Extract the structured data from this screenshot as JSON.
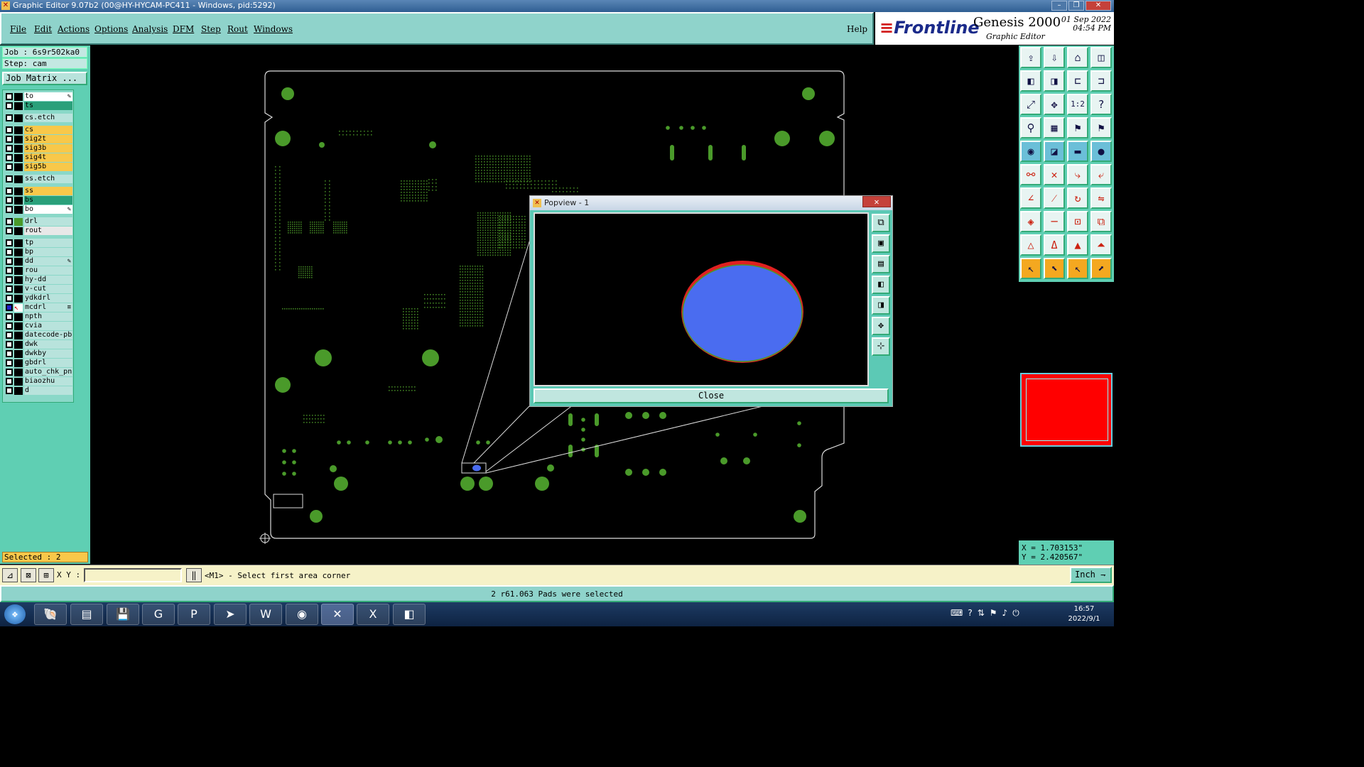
{
  "window": {
    "title": "Graphic Editor 9.07b2 (00@HY-HYCAM-PC411 - Windows, pid:5292)",
    "controls": [
      "minimize-icon",
      "maximize-icon",
      "close-icon"
    ]
  },
  "menu": {
    "items": [
      "File",
      "Edit",
      "Actions",
      "Options",
      "Analysis",
      "DFM",
      "Step",
      "Rout",
      "Windows"
    ],
    "help": "Help"
  },
  "brand": {
    "logo": "Frontline",
    "product": "Genesis 2000",
    "subtitle": "Graphic Editor",
    "date": "01 Sep 2022",
    "time": "04:54 PM"
  },
  "job": {
    "job_line": "Job : 6s9r502ka0",
    "step_line": "Step: cam",
    "matrix_button": "Job Matrix ..."
  },
  "layers": [
    {
      "name": "to",
      "color": "#ffffff",
      "mark": "✎"
    },
    {
      "name": "ts",
      "color": "#2aa07a",
      "mark": ""
    },
    {
      "name": "cs.etch",
      "color": "#b8e3dc",
      "mark": ""
    },
    {
      "name": "cs",
      "color": "#f8c84a",
      "mark": ""
    },
    {
      "name": "sig2t",
      "color": "#f8c84a",
      "mark": ""
    },
    {
      "name": "sig3b",
      "color": "#f8c84a",
      "mark": ""
    },
    {
      "name": "sig4t",
      "color": "#f8c84a",
      "mark": ""
    },
    {
      "name": "sig5b",
      "color": "#f8c84a",
      "mark": ""
    },
    {
      "name": "ss.etch",
      "color": "#b8e3dc",
      "mark": ""
    },
    {
      "name": "ss",
      "color": "#f8c84a",
      "mark": ""
    },
    {
      "name": "bs",
      "color": "#2aa07a",
      "mark": ""
    },
    {
      "name": "bo",
      "color": "#ffffff",
      "mark": "✎"
    },
    {
      "name": "drl",
      "color": "#b8e3dc",
      "mark": ""
    },
    {
      "name": "rout",
      "color": "#e8e8e8",
      "mark": ""
    },
    {
      "name": "tp",
      "color": "#b8e3dc",
      "mark": ""
    },
    {
      "name": "bp",
      "color": "#b8e3dc",
      "mark": ""
    },
    {
      "name": "dd",
      "color": "#b8e3dc",
      "mark": "✎"
    },
    {
      "name": "rou",
      "color": "#b8e3dc",
      "mark": ""
    },
    {
      "name": "hy-dd",
      "color": "#b8e3dc",
      "mark": ""
    },
    {
      "name": "v-cut",
      "color": "#b8e3dc",
      "mark": ""
    },
    {
      "name": "ydkdrl",
      "color": "#b8e3dc",
      "mark": ""
    },
    {
      "name": "mcdrl",
      "color": "#b8e3dc",
      "mark": "≡"
    },
    {
      "name": "npth",
      "color": "#b8e3dc",
      "mark": ""
    },
    {
      "name": "cvia",
      "color": "#b8e3dc",
      "mark": ""
    },
    {
      "name": "datecode-pbo",
      "color": "#b8e3dc",
      "mark": ""
    },
    {
      "name": "dwk",
      "color": "#b8e3dc",
      "mark": ""
    },
    {
      "name": "dwkby",
      "color": "#b8e3dc",
      "mark": ""
    },
    {
      "name": "gbdrl",
      "color": "#b8e3dc",
      "mark": ""
    },
    {
      "name": "auto_chk_pnl",
      "color": "#b8e3dc",
      "mark": ""
    },
    {
      "name": "biaozhu",
      "color": "#b8e3dc",
      "mark": ""
    },
    {
      "name": "d",
      "color": "#b8e3dc",
      "mark": ""
    }
  ],
  "selected_text": "Selected : 2",
  "popview": {
    "title": "Popview - 1",
    "close_button": "Close",
    "tools": [
      "zoom-fit-icon",
      "zoom-in-icon",
      "zoom-out-icon",
      "pan-left-icon",
      "pan-right-icon",
      "zoom-home-icon",
      "zoom-area-icon"
    ]
  },
  "right_tools": {
    "icons": [
      "open-icon",
      "save-icon",
      "home-icon",
      "layout-icon",
      "pan-left-icon",
      "pan-right-icon",
      "step-icon",
      "redraw-icon",
      "fit-icon",
      "zoom-icon",
      "ratio-icon",
      "help-icon",
      "snap-icon",
      "grid-icon",
      "pin-red-icon",
      "pin-red2-icon",
      "pad-add-icon",
      "line-add-icon",
      "measure-icon",
      "hole-icon",
      "connect-icon",
      "intersect-icon",
      "arc-icon",
      "arc-end-icon",
      "line-icon",
      "slash-icon",
      "rotate-icon",
      "mirror-icon",
      "shape-icon",
      "dash-icon",
      "center-icon",
      "cluster-icon",
      "poly-icon",
      "poly2-icon",
      "poly3-icon",
      "poly4-icon",
      "select-icon",
      "select-area-icon",
      "select-net-icon",
      "select-step-icon"
    ]
  },
  "coords": {
    "x": "X = 1.703153\"",
    "y": "Y = 2.420567\""
  },
  "command": {
    "xy_label": "X Y :",
    "xy_value": "",
    "prompt": "<M1> - Select first area corner",
    "unit": "Inch"
  },
  "status_message": "2 r61.063 Pads were selected",
  "taskbar": {
    "apps": [
      "shell-icon",
      "notepad-icon",
      "floppy-icon",
      "genesis-icon",
      "pcb-icon",
      "router-icon",
      "word-icon",
      "eye-icon",
      "graphic-editor-icon",
      "excel-icon",
      "eraser-icon"
    ],
    "tray_icons": [
      "keyboard-icon",
      "help-icon",
      "network-icon",
      "flag-icon",
      "volume-icon",
      "power-icon"
    ],
    "clock_time": "16:57",
    "clock_date": "2022/9/1"
  },
  "colors": {
    "panel": "#5fcfb3",
    "menubar": "#8fd3cb",
    "pcb_green": "#4a9a2a",
    "selected_pad": "#4a6cf0",
    "pad_edge_red": "#e02020",
    "minimap": "#ff0000"
  }
}
